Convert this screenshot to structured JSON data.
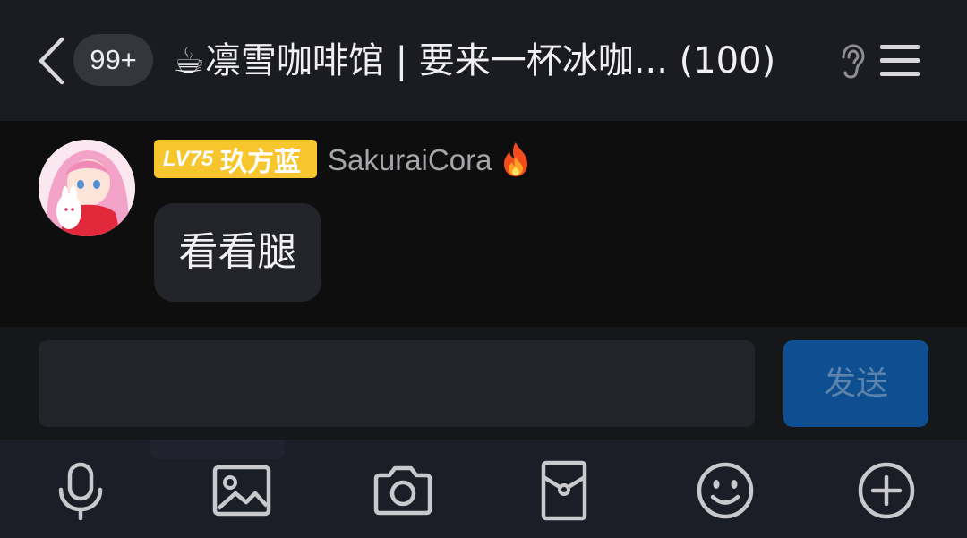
{
  "header": {
    "unread_count": "99+",
    "title_emoji": "☕",
    "title": "凛雪咖啡馆 | 要来一杯冰咖... (100)"
  },
  "message": {
    "level": "LV75",
    "member_title": "玖方蓝",
    "username": "SakuraiCora",
    "text": "看看腿"
  },
  "composer": {
    "placeholder": "",
    "send_label": "发送"
  },
  "toolbar": {
    "items": [
      "mic-icon",
      "image-icon",
      "camera-icon",
      "red-packet-icon",
      "emoji-icon",
      "plus-icon"
    ]
  },
  "colors": {
    "header_bg": "#1a1c21",
    "level_badge": "#f7c52c",
    "send_button": "#0d4f91",
    "toolbar_bg": "#1b1d27"
  }
}
